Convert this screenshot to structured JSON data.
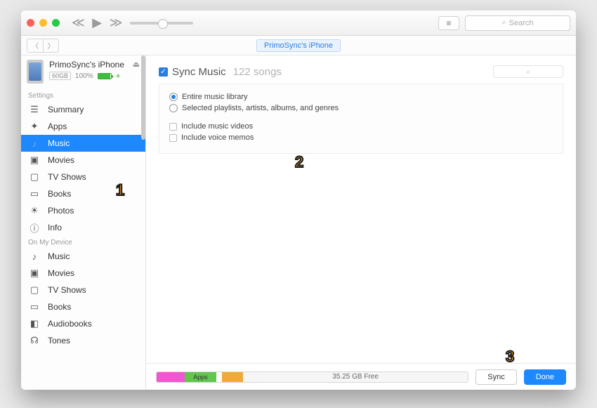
{
  "toolbar": {
    "search_placeholder": "Search"
  },
  "device": {
    "pill": "PrimoSync's iPhone",
    "name": "PrimoSync's iPhone",
    "capacity_badge": "60GB",
    "battery_text": "100%"
  },
  "sidebar": {
    "section_settings": "Settings",
    "settings": [
      {
        "label": "Summary",
        "icon": "i-summary"
      },
      {
        "label": "Apps",
        "icon": "i-apps"
      },
      {
        "label": "Music",
        "icon": "i-music"
      },
      {
        "label": "Movies",
        "icon": "i-movies"
      },
      {
        "label": "TV Shows",
        "icon": "i-tv"
      },
      {
        "label": "Books",
        "icon": "i-books"
      },
      {
        "label": "Photos",
        "icon": "i-photos"
      },
      {
        "label": "Info",
        "icon": "i-info"
      }
    ],
    "section_device": "On My Device",
    "on_device": [
      {
        "label": "Music",
        "icon": "i-music"
      },
      {
        "label": "Movies",
        "icon": "i-movies"
      },
      {
        "label": "TV Shows",
        "icon": "i-tv"
      },
      {
        "label": "Books",
        "icon": "i-books"
      },
      {
        "label": "Audiobooks",
        "icon": "i-audiob"
      },
      {
        "label": "Tones",
        "icon": "i-tones"
      }
    ]
  },
  "main": {
    "sync_label": "Sync Music",
    "song_count": "122 songs",
    "opt_entire": "Entire music library",
    "opt_selected": "Selected playlists, artists, albums, and genres",
    "opt_videos": "Include music videos",
    "opt_memos": "Include voice memos"
  },
  "footer": {
    "apps_seg": "Apps",
    "free": "35.25 GB Free",
    "sync": "Sync",
    "done": "Done"
  },
  "callouts": {
    "c1": "1",
    "c2": "2",
    "c3": "3"
  }
}
